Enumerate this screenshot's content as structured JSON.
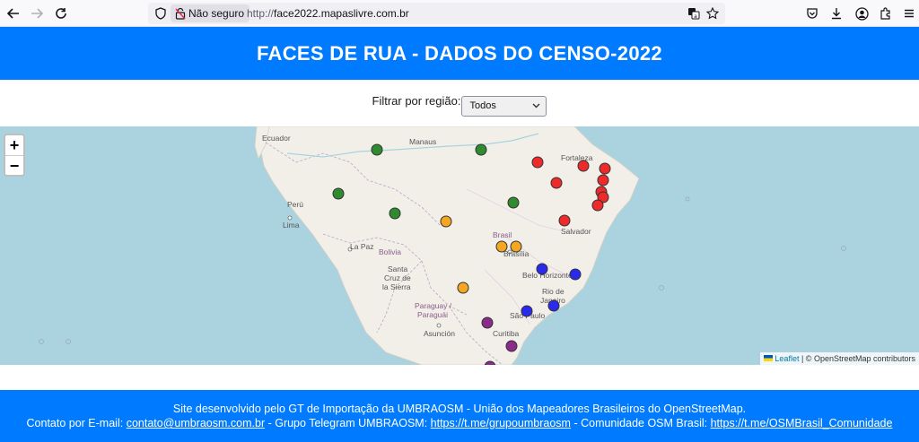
{
  "browser": {
    "insecure_label": "Não seguro",
    "url_prefix": "http://",
    "url_domain": "face2022.mapaslivre.com.br"
  },
  "header": {
    "title": "FACES DE RUA - DADOS DO CENSO-2022"
  },
  "filter": {
    "label": "Filtrar por região:",
    "selected": "Todos"
  },
  "map": {
    "zoom_in": "+",
    "zoom_out": "−",
    "attribution_link": "Leaflet",
    "attribution_sep": " | © ",
    "attribution_text": "OpenStreetMap contributors",
    "labels": {
      "ecuador": "Ecuador",
      "manaus": "Manaus",
      "fortaleza": "Fortaleza",
      "peru": "Perú",
      "lima": "Lima",
      "brasil": "Brasil",
      "salvador": "Salvador",
      "lapaz": "La Paz",
      "bolivia": "Bolivia",
      "brasilia": "Brasília",
      "santa": "Santa",
      "cruz": "Cruz de",
      "sierra": "la Sierra",
      "belo": "Belo Horizonte",
      "rio1": "Rio de",
      "rio2": "Janeiro",
      "paraguay1": "Paraguay /",
      "paraguay2": "Paraguái",
      "saopaulo": "São Paulo",
      "asuncion": "Asunción",
      "curitiba": "Curitiba"
    },
    "colors": {
      "north": "#2e8b2e",
      "northeast": "#ee2a2a",
      "center_west": "#f5a623",
      "southeast": "#2a2aee",
      "south": "#8b2a8b"
    }
  },
  "footer": {
    "line1": "Site desenvolvido pelo GT de Importação da UMBRAOSM - União dos Mapeadores Brasileiros do OpenStreetMap.",
    "contact_prefix": "Contato por E-mail: ",
    "email": "contato@umbraosm.com.br",
    "telegram_prefix": " - Grupo Telegram UMBRAOSM: ",
    "telegram": "https://t.me/grupoumbraosm",
    "community_prefix": " - Comunidade OSM Brasil: ",
    "community": "https://t.me/OSMBrasil_Comunidade"
  }
}
